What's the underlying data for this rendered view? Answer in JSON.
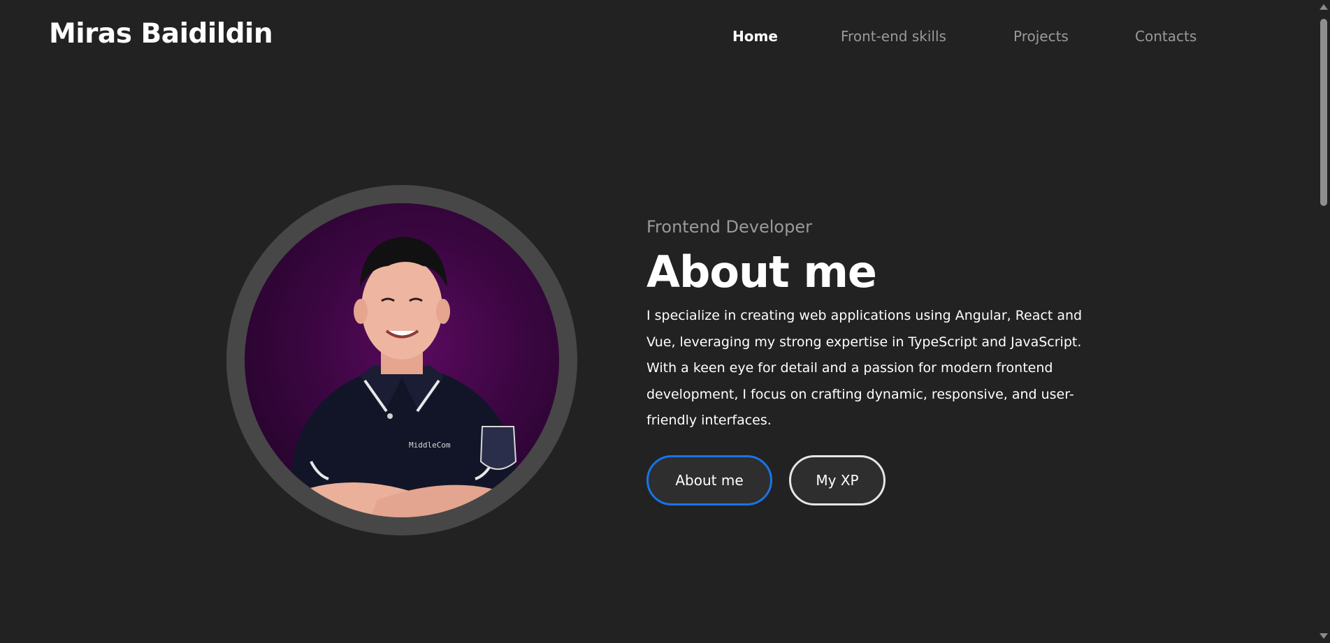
{
  "header": {
    "logo": "Miras Baidildin",
    "nav": [
      {
        "label": "Home",
        "active": true
      },
      {
        "label": "Front-end skills",
        "active": false
      },
      {
        "label": "Projects",
        "active": false
      },
      {
        "label": "Contacts",
        "active": false
      }
    ]
  },
  "hero": {
    "subtitle": "Frontend Developer",
    "title": "About me",
    "description": "I specialize in creating web applications using Angular, React and Vue, leveraging my strong expertise in TypeScript and JavaScript. With a keen eye for detail and a passion for modern frontend development, I focus on crafting dynamic, responsive, and user-friendly interfaces.",
    "buttons": {
      "about_label": "About me",
      "xp_label": "My XP"
    }
  },
  "colors": {
    "background": "#222222",
    "accent_blue": "#1a73e8",
    "muted_text": "#9a9a9a",
    "portrait_ring": "#474747",
    "portrait_bg": "#4a0850"
  },
  "icons": {
    "portrait": "profile-photo"
  }
}
